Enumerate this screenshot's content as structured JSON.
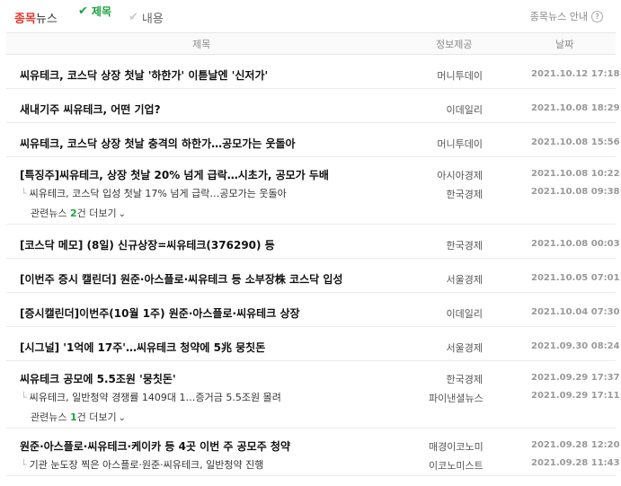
{
  "topbar": {
    "brand_red": "종목",
    "brand_rest": "뉴스",
    "filter_title": "제목",
    "filter_content": "내용",
    "help_label": "종목뉴스 안내",
    "help_q": "?"
  },
  "table": {
    "headers": {
      "title": "제목",
      "source": "정보제공",
      "date": "날짜"
    }
  },
  "news": [
    {
      "title": "씨유테크, 코스닥 상장 첫날 '하한가' 이튿날엔 '신저가'",
      "source": "머니투데이",
      "date": "2021.10.12 17:18"
    },
    {
      "title": "새내기주 씨유테크, 어떤 기업?",
      "source": "이데일리",
      "date": "2021.10.08 18:29"
    },
    {
      "title": "씨유테크, 코스닥 상장 첫날 충격의 하한가…공모가는 웃돌아",
      "source": "머니투데이",
      "date": "2021.10.08 15:56"
    },
    {
      "title": "[특징주]씨유테크, 상장 첫날 20% 넘게 급락…시초가, 공모가 두배",
      "source": "아시아경제",
      "date": "2021.10.08 10:22",
      "related": {
        "title": "씨유테크, 코스닥 입성 첫날 17% 넘게 급락…공모가는 웃돌아",
        "source": "한국경제",
        "date": "2021.10.08 09:38"
      },
      "more": {
        "prefix": "관련뉴스 ",
        "count": "2",
        "suffix": "건 더보기"
      }
    },
    {
      "title": "[코스닥 메모] (8일) 신규상장=씨유테크(376290) 등",
      "source": "한국경제",
      "date": "2021.10.08 00:03"
    },
    {
      "title": "[이번주 증시 캘린더] 원준·아스플로·씨유테크 등 소부장株 코스닥 입성",
      "source": "서울경제",
      "date": "2021.10.05 07:01"
    },
    {
      "title": "[증시캘린더]이번주(10월 1주) 원준·아스플로·씨유테크 상장",
      "source": "이데일리",
      "date": "2021.10.04 07:30"
    },
    {
      "title": "[시그널] '1억에 17주'…씨유테크 청약에 5兆 뭉칫돈",
      "source": "서울경제",
      "date": "2021.09.30 08:24"
    },
    {
      "title": "씨유테크 공모에 5.5조원 '뭉칫돈'",
      "source": "한국경제",
      "date": "2021.09.29 17:37",
      "related": {
        "title": "씨유테크, 일반청약 경쟁률 1409대 1…증거금 5.5조원 몰려",
        "source": "파이낸셜뉴스",
        "date": "2021.09.29 17:11"
      },
      "more": {
        "prefix": "관련뉴스 ",
        "count": "1",
        "suffix": "건 더보기"
      }
    },
    {
      "title": "원준·아스플로·씨유테크·케이카 등 4곳 이번 주 공모주 청약",
      "source": "매경이코노미",
      "date": "2021.09.28 12:20",
      "related": {
        "title": "기관 눈도장 찍은 아스플로·원준·씨유테크, 일반청약 진행",
        "source": "이코노미스트",
        "date": "2021.09.28 11:43"
      }
    }
  ]
}
